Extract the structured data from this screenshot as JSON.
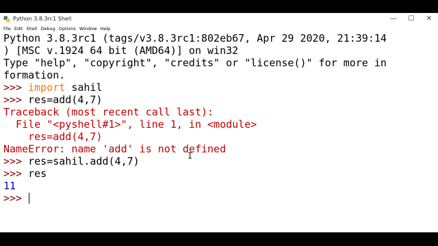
{
  "window": {
    "title": "Python 3.8.3rc1 Shell",
    "icon": "python-icon",
    "controls": {
      "minimize": "—",
      "maximize": "☐",
      "close": "✕"
    }
  },
  "menu": {
    "items": [
      "File",
      "Edit",
      "Shell",
      "Debug",
      "Options",
      "Window",
      "Help"
    ]
  },
  "shell": {
    "banner_line1": "Python 3.8.3rc1 (tags/v3.8.3rc1:802eb67, Apr 29 2020, 21:39:14",
    "banner_line2": ") [MSC v.1924 64 bit (AMD64)] on win32",
    "banner_line3": "Type \"help\", \"copyright\", \"credits\" or \"license()\" for more in",
    "banner_line4": "formation.",
    "prompt": ">>> ",
    "cmd1_keyword": "import",
    "cmd1_rest": " sahil",
    "cmd2": "res=add(4,7)",
    "tb_line1": "Traceback (most recent call last):",
    "tb_line2": "  File \"<pyshell#1>\", line 1, in <module>",
    "tb_line3": "    res=add(4,7)",
    "tb_line4": "NameError: name 'add' is not defined",
    "cmd3": "res=sahil.add(4,7)",
    "cmd4": "res",
    "output1": "11",
    "colors": {
      "prompt": "#7f0000",
      "keyword": "#ff7700",
      "error": "#c00000",
      "output": "#0000c0"
    }
  }
}
